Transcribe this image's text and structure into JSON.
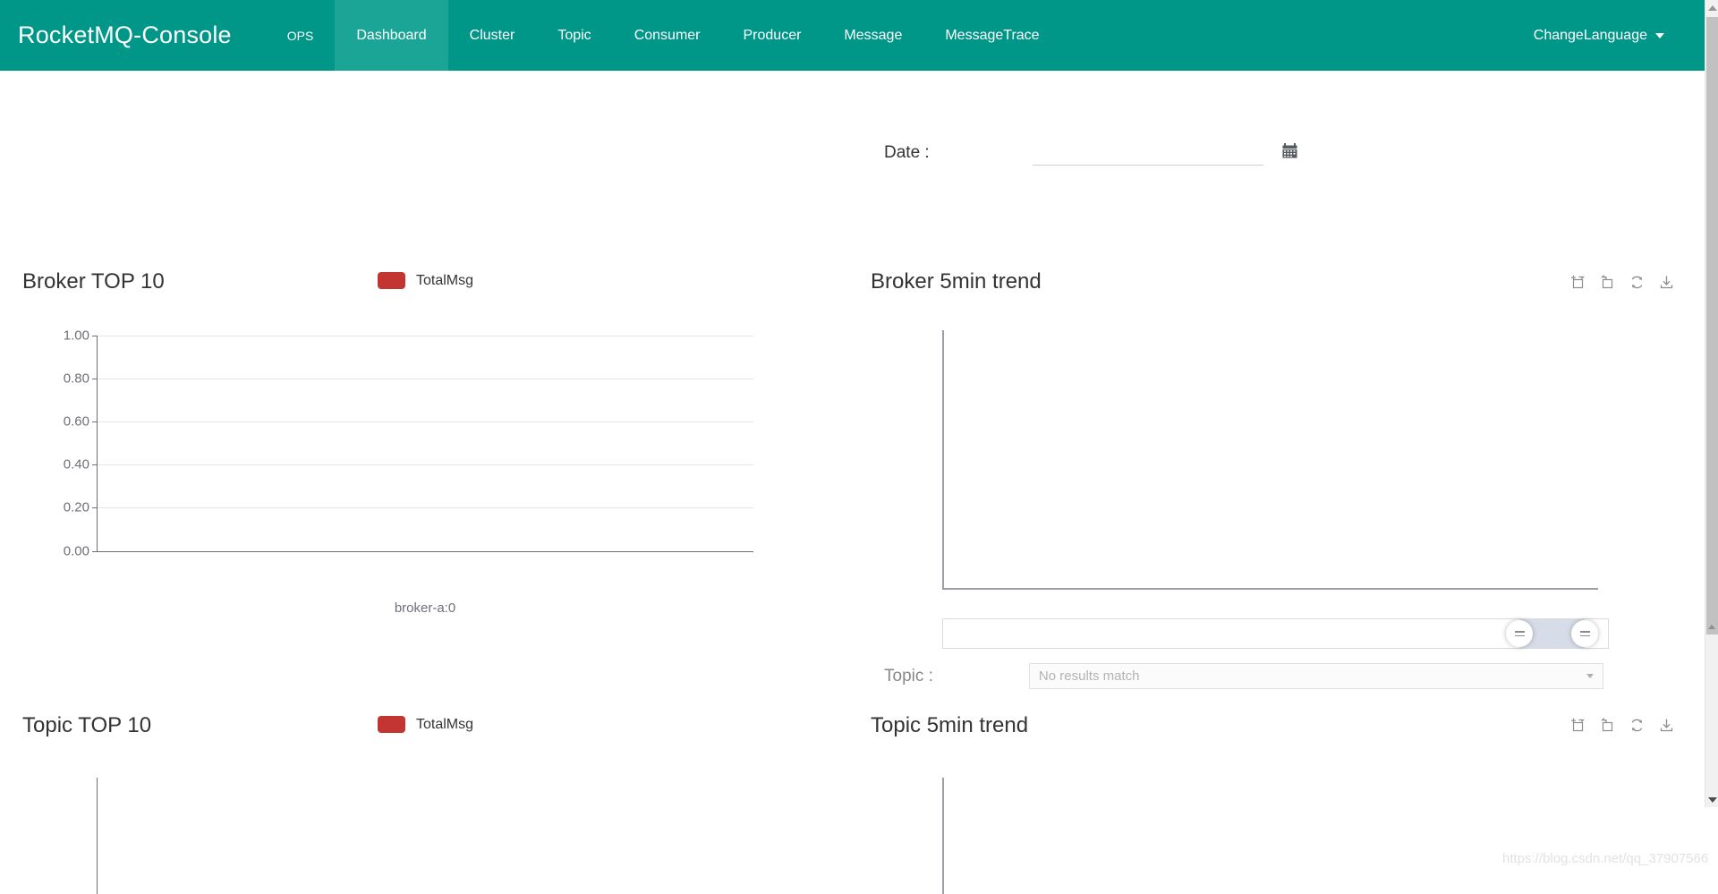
{
  "navbar": {
    "brand": "RocketMQ-Console",
    "items": [
      {
        "label": "OPS",
        "active": false
      },
      {
        "label": "Dashboard",
        "active": true
      },
      {
        "label": "Cluster",
        "active": false
      },
      {
        "label": "Topic",
        "active": false
      },
      {
        "label": "Consumer",
        "active": false
      },
      {
        "label": "Producer",
        "active": false
      },
      {
        "label": "Message",
        "active": false
      },
      {
        "label": "MessageTrace",
        "active": false
      }
    ],
    "language": {
      "label": "ChangeLanguage",
      "icon": "chevron-down-icon"
    },
    "background_color": "#009688",
    "active_color": "#1aa596"
  },
  "filters": {
    "date": {
      "label": "Date :",
      "value": "",
      "placeholder": "",
      "icon": "calendar-icon"
    },
    "topic": {
      "label": "Topic :",
      "selected": "No results match",
      "icon": "chevron-down-icon"
    }
  },
  "panels": {
    "broker_top10": {
      "title": "Broker TOP 10",
      "legend": [
        {
          "label": "TotalMsg",
          "color": "#c23531"
        }
      ]
    },
    "broker_trend": {
      "title": "Broker 5min trend",
      "toolbox": [
        {
          "name": "data-zoom-icon",
          "title": "Data Zoom"
        },
        {
          "name": "restore-zoom-icon",
          "title": "Zoom Reset"
        },
        {
          "name": "refresh-icon",
          "title": "Restore"
        },
        {
          "name": "download-icon",
          "title": "Save As Image"
        }
      ]
    },
    "topic_top10": {
      "title": "Topic TOP 10",
      "legend": [
        {
          "label": "TotalMsg",
          "color": "#c23531"
        }
      ]
    },
    "topic_trend": {
      "title": "Topic 5min trend",
      "toolbox": [
        {
          "name": "data-zoom-icon",
          "title": "Data Zoom"
        },
        {
          "name": "restore-zoom-icon",
          "title": "Zoom Reset"
        },
        {
          "name": "refresh-icon",
          "title": "Restore"
        },
        {
          "name": "download-icon",
          "title": "Save As Image"
        }
      ]
    }
  },
  "chart_data": [
    {
      "type": "bar",
      "title": "Broker TOP 10",
      "categories": [
        "broker-a:0"
      ],
      "series": [
        {
          "name": "TotalMsg",
          "values": [
            0
          ]
        }
      ],
      "yticks": [
        "1.00",
        "0.80",
        "0.60",
        "0.40",
        "0.20",
        "0.00"
      ],
      "ylim": [
        0,
        1
      ],
      "xlabel": "",
      "ylabel": "",
      "grid": true,
      "legend_position": "top-center"
    },
    {
      "type": "line",
      "title": "Broker 5min trend",
      "categories": [],
      "series": [],
      "yticks": [],
      "xlabel": "",
      "ylabel": "",
      "grid": false,
      "legend_position": "none"
    },
    {
      "type": "bar",
      "title": "Topic TOP 10",
      "categories": [],
      "series": [
        {
          "name": "TotalMsg",
          "values": []
        }
      ],
      "yticks": [],
      "xlabel": "",
      "ylabel": "",
      "grid": false,
      "legend_position": "top-center"
    },
    {
      "type": "line",
      "title": "Topic 5min trend",
      "categories": [],
      "series": [],
      "yticks": [],
      "xlabel": "",
      "ylabel": "",
      "grid": false,
      "legend_position": "none"
    }
  ],
  "watermark": "https://blog.csdn.net/qq_37907566"
}
